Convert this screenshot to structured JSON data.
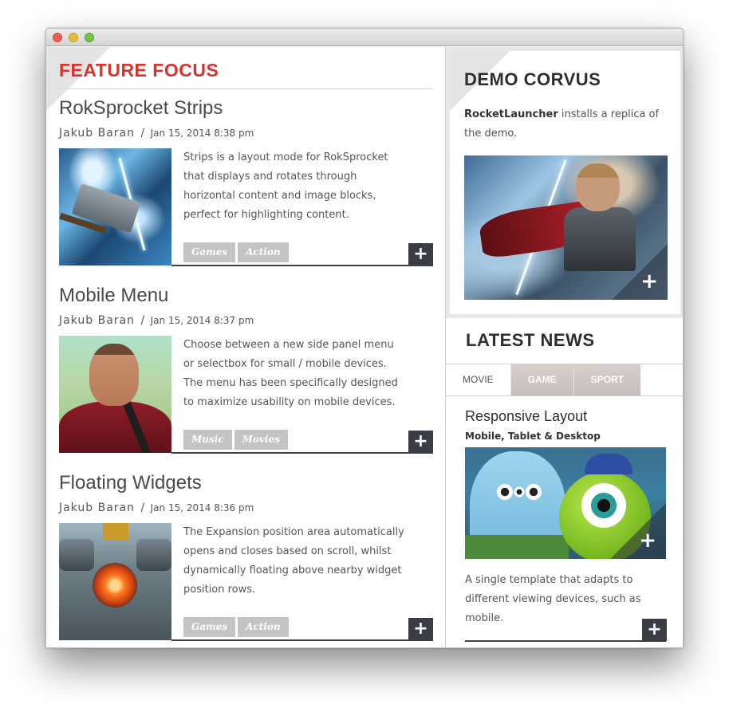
{
  "section_title": "Feature Focus",
  "articles": [
    {
      "title": "RokSprocket Strips",
      "author": "Jakub Baran",
      "separator": "/",
      "date": "Jan 15, 2014 8:38 pm",
      "description": "Strips is a layout mode for RokSprocket that displays and rotates through horizontal content and image blocks, perfect for highlighting content.",
      "tags": [
        "Games",
        "Action"
      ],
      "more_label": "+"
    },
    {
      "title": "Mobile Menu",
      "author": "Jakub Baran",
      "separator": "/",
      "date": "Jan 15, 2014 8:37 pm",
      "description": "Choose between a new side panel menu or selectbox for small / mobile devices. The menu has been specifically designed to maximize usability on mobile devices.",
      "tags": [
        "Music",
        "Movies"
      ],
      "more_label": "+"
    },
    {
      "title": "Floating Widgets",
      "author": "Jakub Baran",
      "separator": "/",
      "date": "Jan 15, 2014 8:36 pm",
      "description": "The Expansion position area automatically opens and closes based on scroll, whilst dynamically floating above nearby widget position rows.",
      "tags": [
        "Games",
        "Action"
      ],
      "more_label": "+"
    }
  ],
  "demo": {
    "title": "Demo Corvus",
    "text_strong": "RocketLauncher",
    "text_rest": " installs a replica of the demo.",
    "image_plus": "+"
  },
  "news": {
    "title": "Latest News",
    "tabs": [
      {
        "label": "Movie",
        "active": true
      },
      {
        "label": "Game",
        "active": false
      },
      {
        "label": "Sport",
        "active": false
      }
    ],
    "item_title": "Responsive Layout",
    "item_subtitle": "Mobile, Tablet & Desktop",
    "item_description": "A single template that adapts to different viewing devices, such as mobile.",
    "image_plus": "+",
    "more_label": "+"
  },
  "colors": {
    "accent_red": "#d9332b",
    "dark_button": "#3a3d45",
    "tag_gray": "#c4c4c4"
  }
}
